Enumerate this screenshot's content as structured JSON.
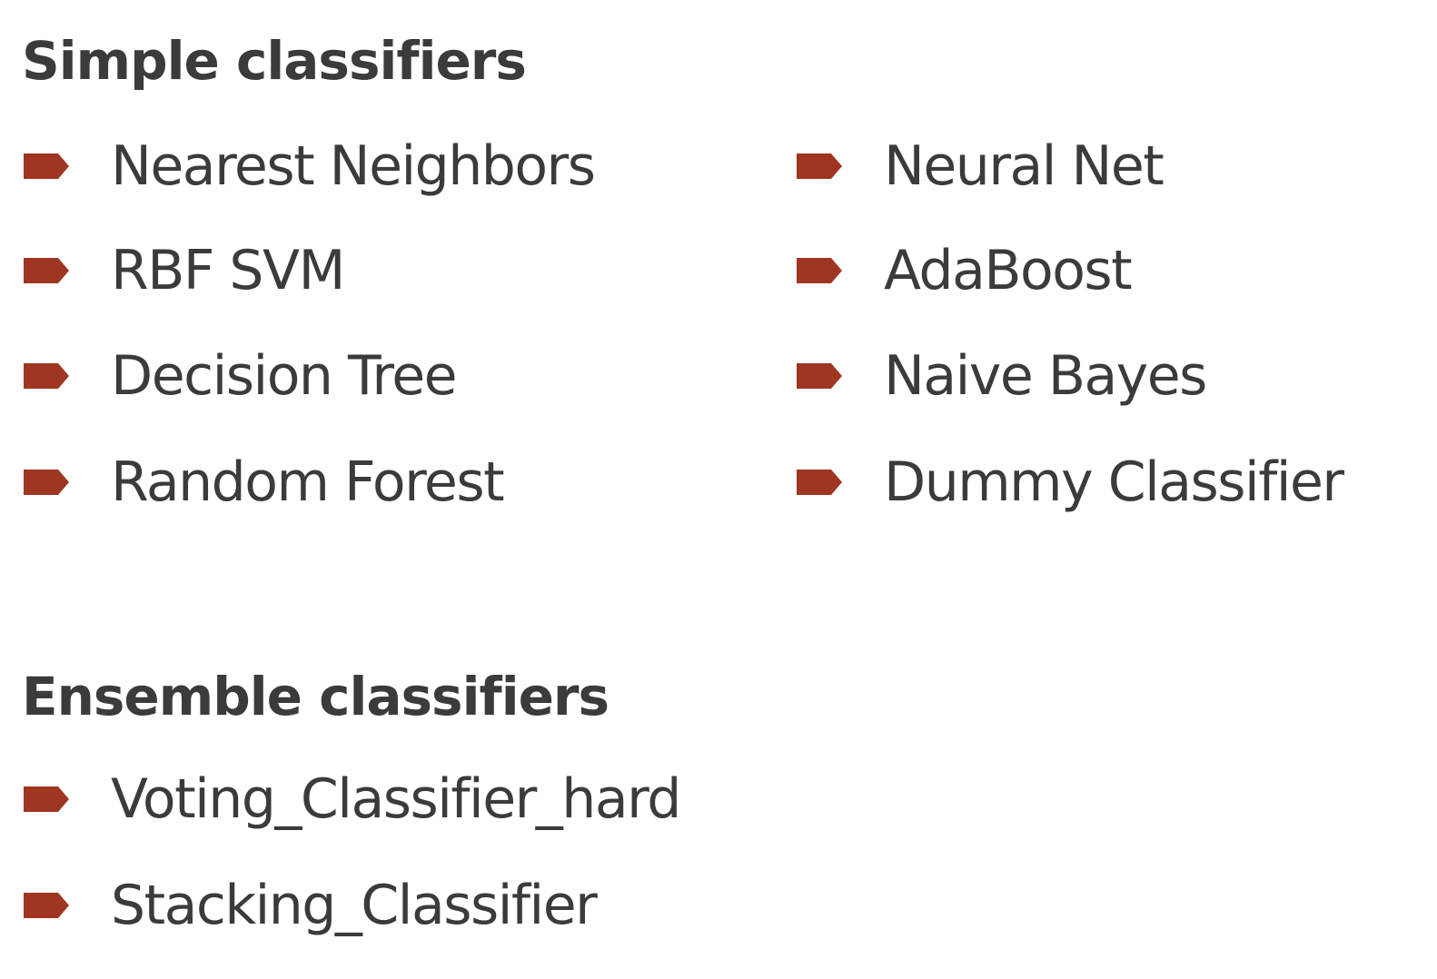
{
  "bullet_color": "#9e3622",
  "text_color": "#3b3b3b",
  "simple": {
    "heading": "Simple classifiers",
    "left_items": [
      "Nearest Neighbors",
      "RBF SVM",
      "Decision Tree",
      "Random Forest"
    ],
    "right_items": [
      "Neural Net",
      "AdaBoost",
      "Naive Bayes",
      "Dummy Classifier"
    ]
  },
  "ensemble": {
    "heading": "Ensemble classifiers",
    "items": [
      "Voting_Classifier_hard",
      "Stacking_Classifier"
    ]
  }
}
